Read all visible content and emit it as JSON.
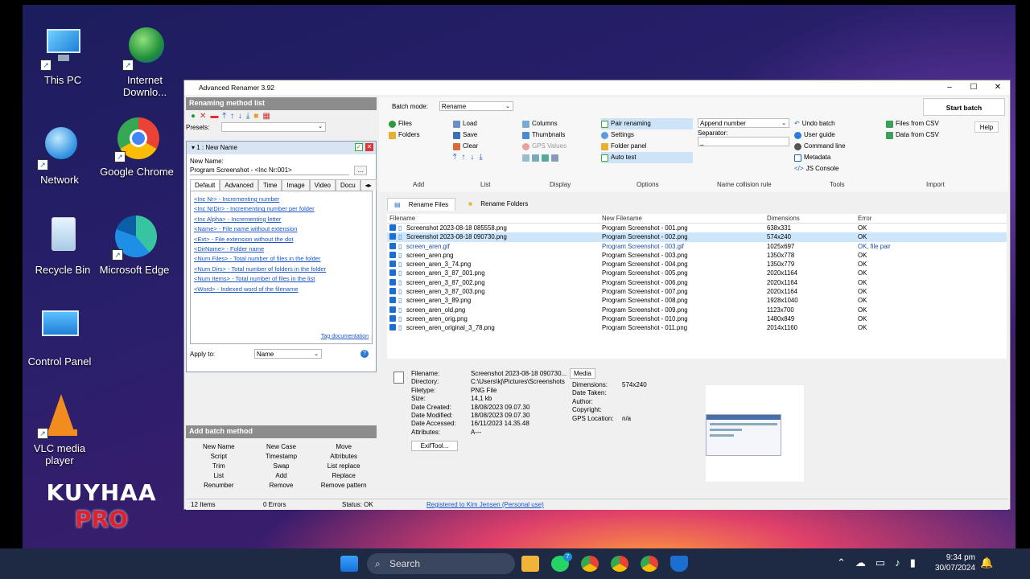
{
  "desktop_icons": [
    {
      "label": "This PC",
      "icon": "computer-icon"
    },
    {
      "label": "Internet Downlo...",
      "icon": "idm-icon"
    },
    {
      "label": "Network",
      "icon": "network-globe-icon"
    },
    {
      "label": "Google Chrome",
      "icon": "chrome-icon"
    },
    {
      "label": "Recycle Bin",
      "icon": "recycle-bin-icon"
    },
    {
      "label": "Microsoft Edge",
      "icon": "edge-icon"
    },
    {
      "label": "Control Panel",
      "icon": "control-panel-icon"
    },
    {
      "label": "VLC media player",
      "icon": "vlc-icon"
    }
  ],
  "brand": {
    "line1": "KUYHAA",
    "line2": "PRO"
  },
  "window": {
    "title": "Advanced Renamer 3.92",
    "min": "–",
    "max": "☐",
    "close": "✕"
  },
  "left": {
    "method_list_title": "Renaming method list",
    "presets_label": "Presets:",
    "method_title": "1 : New Name",
    "new_name_label": "New Name:",
    "new_name_value": "Program Screenshot - <Inc Nr:001>",
    "browse": "...",
    "tabs": [
      "Default",
      "Advanced",
      "Time",
      "Image",
      "Video",
      "Docu"
    ],
    "tags": [
      "<Inc Nr> - Incrementing number",
      "<Inc NrDir> - Incrementing number per folder",
      "<Inc Alpha> - Incrementing letter",
      "<Name> - File name without extension",
      "<Ext> - File extension without the dot",
      "<DirName> - Folder name",
      "<Num Files> - Total number of files in the folder",
      "<Num Dirs> - Total number of folders in the folder",
      "<Num Items> - Total number of files in the list",
      "<Word> - Indexed word of the filename"
    ],
    "tag_doc": "Tag documentation",
    "apply_to_label": "Apply to:",
    "apply_to_value": "Name",
    "add_batch_title": "Add batch method",
    "batch_methods": [
      "New Name",
      "New Case",
      "Move",
      "Script",
      "Timestamp",
      "Attributes",
      "Trim",
      "Swap",
      "List replace",
      "List",
      "Add",
      "Replace",
      "Renumber",
      "Remove",
      "Remove pattern"
    ]
  },
  "ribbon": {
    "batch_mode_label": "Batch mode:",
    "batch_mode_value": "Rename",
    "start_batch": "Start batch",
    "help": "Help",
    "add": {
      "items": [
        "Files",
        "Folders"
      ],
      "label": "Add"
    },
    "list": {
      "items": [
        "Load",
        "Save",
        "Clear"
      ],
      "label": "List"
    },
    "display": {
      "items": [
        "Columns",
        "Thumbnails",
        "GPS Values"
      ],
      "label": "Display"
    },
    "options": {
      "items": [
        "Pair renaming",
        "Settings",
        "Folder panel",
        "Auto test"
      ],
      "label": "Options"
    },
    "collision": {
      "value": "Append number",
      "separator_label": "Separator:",
      "separator_value": "_",
      "label": "Name collision rule"
    },
    "tools": {
      "items": [
        "Undo batch",
        "User guide",
        "Command line",
        "Metadata",
        "JS Console"
      ],
      "label": "Tools"
    },
    "import": {
      "items": [
        "Files from CSV",
        "Data from CSV"
      ],
      "label": "Import"
    }
  },
  "file_tabs": [
    "Rename Files",
    "Rename Folders"
  ],
  "columns": [
    "Filename",
    "New Filename",
    "Dimensions",
    "Error"
  ],
  "rows": [
    [
      "Screenshot 2023-08-18 085558.png",
      "Program Screenshot - 001.png",
      "638x331",
      "OK"
    ],
    [
      "Screenshot 2023-08-18 090730.png",
      "Program Screenshot - 002.png",
      "574x240",
      "OK"
    ],
    [
      "screen_aren.gif",
      "Program Screenshot - 003.gif",
      "1025x697",
      "OK, file pair"
    ],
    [
      "screen_aren.png",
      "Program Screenshot - 003.png",
      "1350x778",
      "OK"
    ],
    [
      "screen_aren_3_74.png",
      "Program Screenshot - 004.png",
      "1350x779",
      "OK"
    ],
    [
      "screen_aren_3_87_001.png",
      "Program Screenshot - 005.png",
      "2020x1164",
      "OK"
    ],
    [
      "screen_aren_3_87_002.png",
      "Program Screenshot - 006.png",
      "2020x1164",
      "OK"
    ],
    [
      "screen_aren_3_87_003.png",
      "Program Screenshot - 007.png",
      "2020x1164",
      "OK"
    ],
    [
      "screen_aren_3_89.png",
      "Program Screenshot - 008.png",
      "1928x1040",
      "OK"
    ],
    [
      "screen_aren_old.png",
      "Program Screenshot - 009.png",
      "1123x700",
      "OK"
    ],
    [
      "screen_aren_orig.png",
      "Program Screenshot - 010.png",
      "1480x849",
      "OK"
    ],
    [
      "screen_aren_original_3_78.png",
      "Program Screenshot - 011.png",
      "2014x1160",
      "OK"
    ]
  ],
  "details": {
    "labels": [
      "Filename:",
      "Directory:",
      "Filetype:",
      "Size:",
      "Date Created:",
      "Date Modified:",
      "Date Accessed:",
      "Attributes:"
    ],
    "values": [
      "Screenshot 2023-08-18 090730...",
      "C:\\Users\\kj\\Pictures\\Screenshots",
      "PNG File",
      "14,1 kb",
      "18/08/2023 09.07.30",
      "18/08/2023 09.07.30",
      "16/11/2023 14.35.48",
      "A---"
    ],
    "exif_button": "ExifTool...",
    "media_tab": "Media",
    "media_labels": [
      "Dimensions:",
      "Date Taken:",
      "Author:",
      "Copyright:",
      "GPS Location:"
    ],
    "media_values": [
      "574x240",
      "",
      "",
      "",
      "n/a"
    ]
  },
  "status": {
    "items": "12 Items",
    "errors": "0 Errors",
    "status": "Status: OK",
    "registered": "Registered to Kim Jensen (Personal use)"
  },
  "taskbar": {
    "search": "Search",
    "time": "9:34 pm",
    "date": "30/07/2024",
    "whatsapp_badge": "7"
  }
}
